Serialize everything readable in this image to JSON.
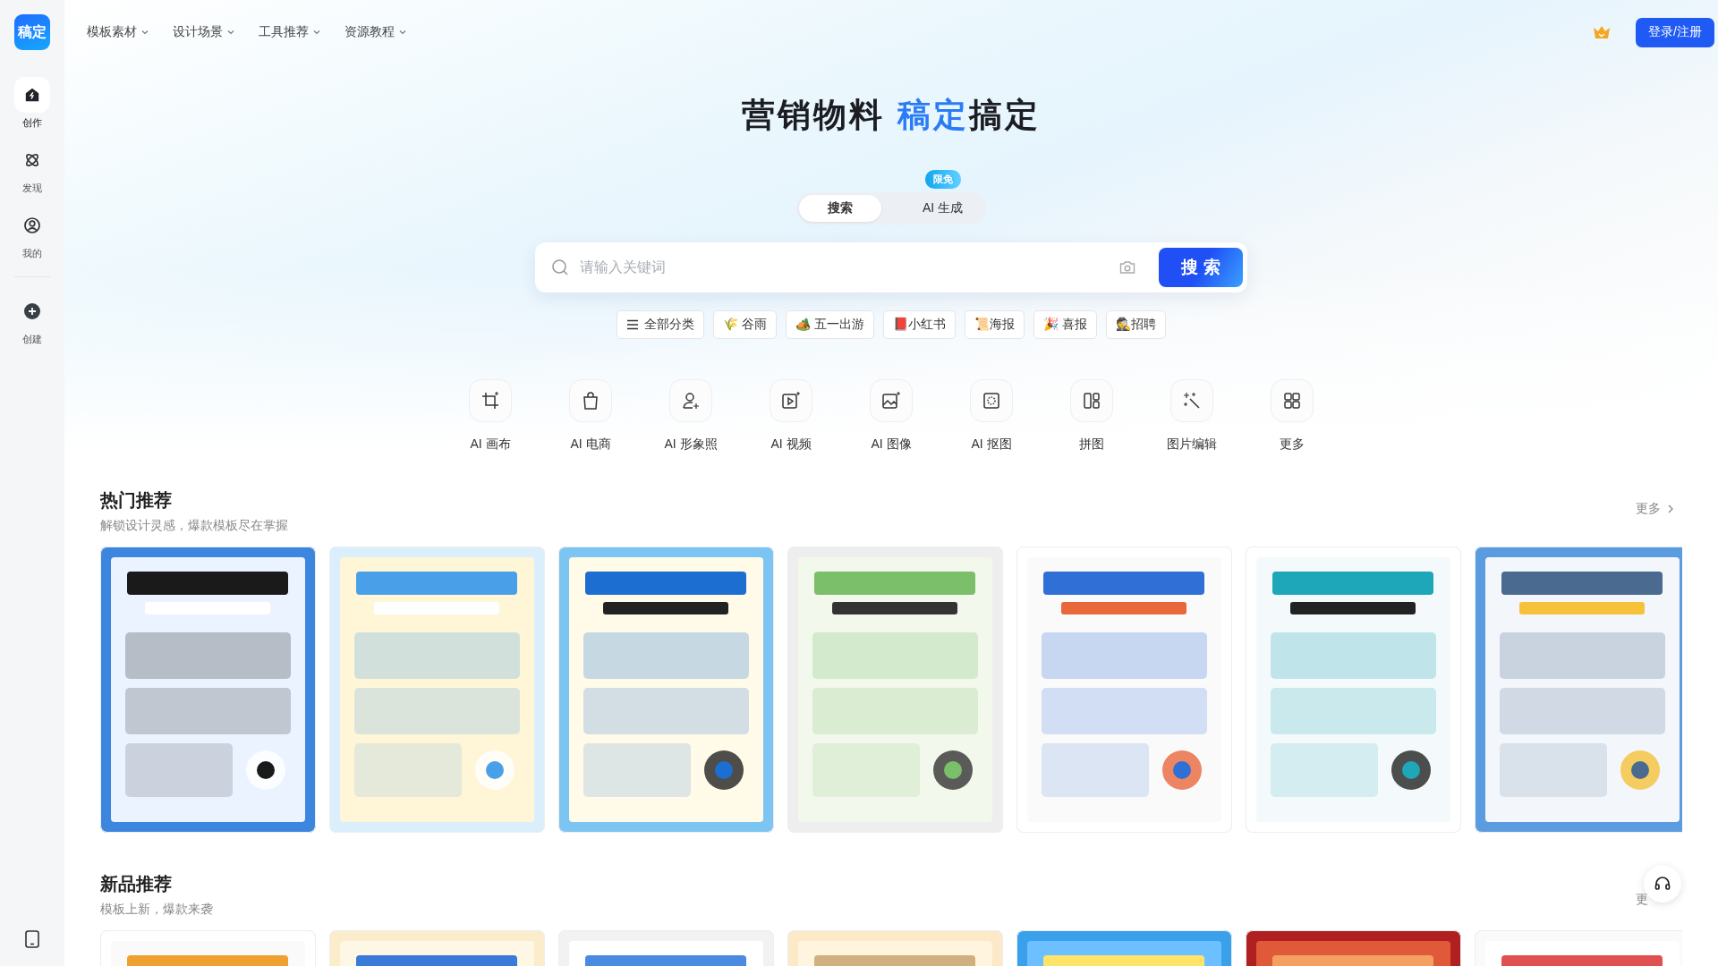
{
  "logo": {
    "text": "稿定"
  },
  "sidebar": {
    "items": [
      {
        "label": "创作",
        "selected": true
      },
      {
        "label": "发现",
        "selected": false
      },
      {
        "label": "我的",
        "selected": false
      }
    ],
    "create": {
      "label": "创建"
    }
  },
  "top_nav": {
    "menus": [
      "模板素材",
      "设计场景",
      "工具推荐",
      "资源教程"
    ],
    "login_button": "登录/注册"
  },
  "hero": {
    "title_before": "营销物料 ",
    "title_brand": "稿定",
    "title_after": "搞定",
    "mode_tabs": [
      {
        "label": "搜索",
        "selected": true
      },
      {
        "label": "AI 生成",
        "selected": false,
        "badge": "限免"
      }
    ],
    "search": {
      "placeholder": "请输入关键词",
      "button": "搜 索"
    },
    "tags": [
      "全部分类",
      "🌾 谷雨",
      "🏕️ 五一出游",
      "📕小红书",
      "📜海报",
      "🎉 喜报",
      "🕵️招聘"
    ]
  },
  "tools": [
    "AI 画布",
    "AI 电商",
    "AI 形象照",
    "AI 视频",
    "AI 图像",
    "AI 抠图",
    "拼图",
    "图片编辑",
    "更多"
  ],
  "sections": [
    {
      "title": "热门推荐",
      "subtitle": "解锁设计灵感，爆款模板尽在掌握",
      "more": "更多"
    },
    {
      "title": "新品推荐",
      "subtitle": "模板上新，爆款来袭",
      "more": "更"
    }
  ]
}
